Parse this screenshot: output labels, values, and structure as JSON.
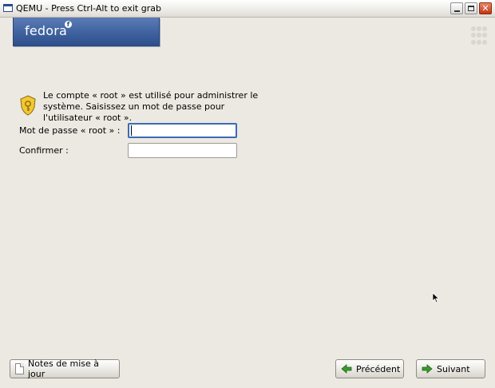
{
  "window": {
    "title": "QEMU - Press Ctrl-Alt to exit grab",
    "icon": "window-icon",
    "controls": [
      "minimize-icon",
      "maximize-icon",
      "close-icon"
    ]
  },
  "header": {
    "logo_text": "fedora",
    "logo_mark": "f",
    "decoration_icon": "dots-grid-icon"
  },
  "form": {
    "icon": "key-badge-icon",
    "intro": "Le compte « root » est utilisé pour administrer le système. Saisissez un mot de passe pour l'utilisateur « root ».",
    "password_label": "Mot de passe « root » :",
    "password_value": "",
    "confirm_label": "Confirmer :",
    "confirm_value": ""
  },
  "footer": {
    "notes_label": "Notes de mise à jour",
    "notes_icon": "document-icon",
    "back_label": "Précédent",
    "back_icon": "arrow-left-icon",
    "next_label": "Suivant",
    "next_icon": "arrow-right-icon"
  },
  "colors": {
    "background": "#ece9e2",
    "banner": "#3f629f",
    "focus": "#3b6bb7",
    "arrow_green": "#3a9a2e"
  }
}
